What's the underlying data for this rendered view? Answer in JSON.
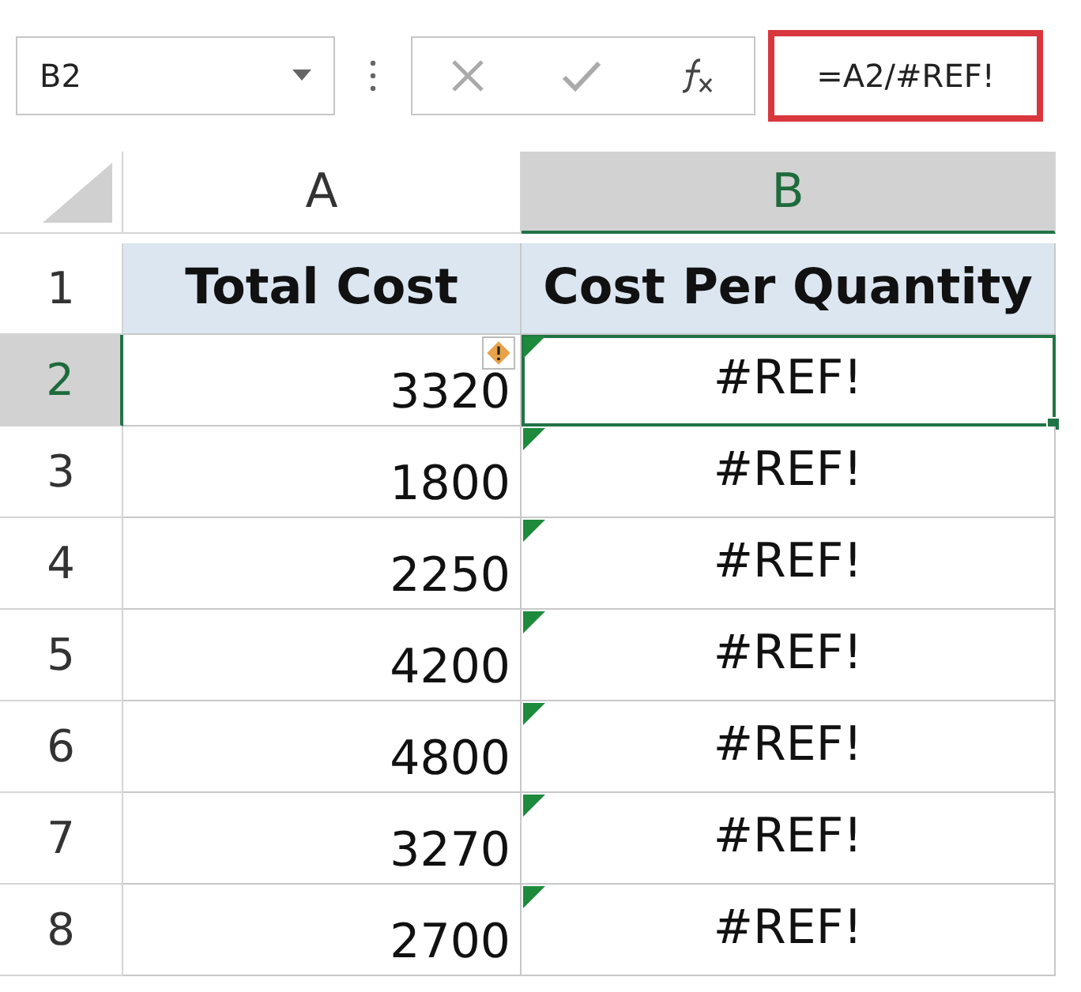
{
  "name_box": {
    "value": "B2"
  },
  "formula_bar": {
    "value": "=A2/#REF!",
    "highlighted": true
  },
  "columns": [
    {
      "label": "A",
      "selected": false
    },
    {
      "label": "B",
      "selected": true
    }
  ],
  "rows": [
    {
      "number": "1",
      "selected": false,
      "cells": [
        {
          "kind": "header",
          "value": "Total Cost",
          "selected": false,
          "error_flag": false,
          "warning": false
        },
        {
          "kind": "header",
          "value": "Cost Per Quantity",
          "selected": false,
          "error_flag": false,
          "warning": false
        }
      ]
    },
    {
      "number": "2",
      "selected": true,
      "cells": [
        {
          "kind": "number",
          "value": "3320",
          "selected": false,
          "error_flag": false,
          "warning": true
        },
        {
          "kind": "error",
          "value": "#REF!",
          "selected": true,
          "error_flag": true,
          "warning": false
        }
      ]
    },
    {
      "number": "3",
      "selected": false,
      "cells": [
        {
          "kind": "number",
          "value": "1800",
          "selected": false,
          "error_flag": false,
          "warning": false
        },
        {
          "kind": "error",
          "value": "#REF!",
          "selected": false,
          "error_flag": true,
          "warning": false
        }
      ]
    },
    {
      "number": "4",
      "selected": false,
      "cells": [
        {
          "kind": "number",
          "value": "2250",
          "selected": false,
          "error_flag": false,
          "warning": false
        },
        {
          "kind": "error",
          "value": "#REF!",
          "selected": false,
          "error_flag": true,
          "warning": false
        }
      ]
    },
    {
      "number": "5",
      "selected": false,
      "cells": [
        {
          "kind": "number",
          "value": "4200",
          "selected": false,
          "error_flag": false,
          "warning": false
        },
        {
          "kind": "error",
          "value": "#REF!",
          "selected": false,
          "error_flag": true,
          "warning": false
        }
      ]
    },
    {
      "number": "6",
      "selected": false,
      "cells": [
        {
          "kind": "number",
          "value": "4800",
          "selected": false,
          "error_flag": false,
          "warning": false
        },
        {
          "kind": "error",
          "value": "#REF!",
          "selected": false,
          "error_flag": true,
          "warning": false
        }
      ]
    },
    {
      "number": "7",
      "selected": false,
      "cells": [
        {
          "kind": "number",
          "value": "3270",
          "selected": false,
          "error_flag": false,
          "warning": false
        },
        {
          "kind": "error",
          "value": "#REF!",
          "selected": false,
          "error_flag": true,
          "warning": false
        }
      ]
    },
    {
      "number": "8",
      "selected": false,
      "cells": [
        {
          "kind": "number",
          "value": "2700",
          "selected": false,
          "error_flag": false,
          "warning": false
        },
        {
          "kind": "error",
          "value": "#REF!",
          "selected": false,
          "error_flag": true,
          "warning": false
        }
      ]
    }
  ]
}
